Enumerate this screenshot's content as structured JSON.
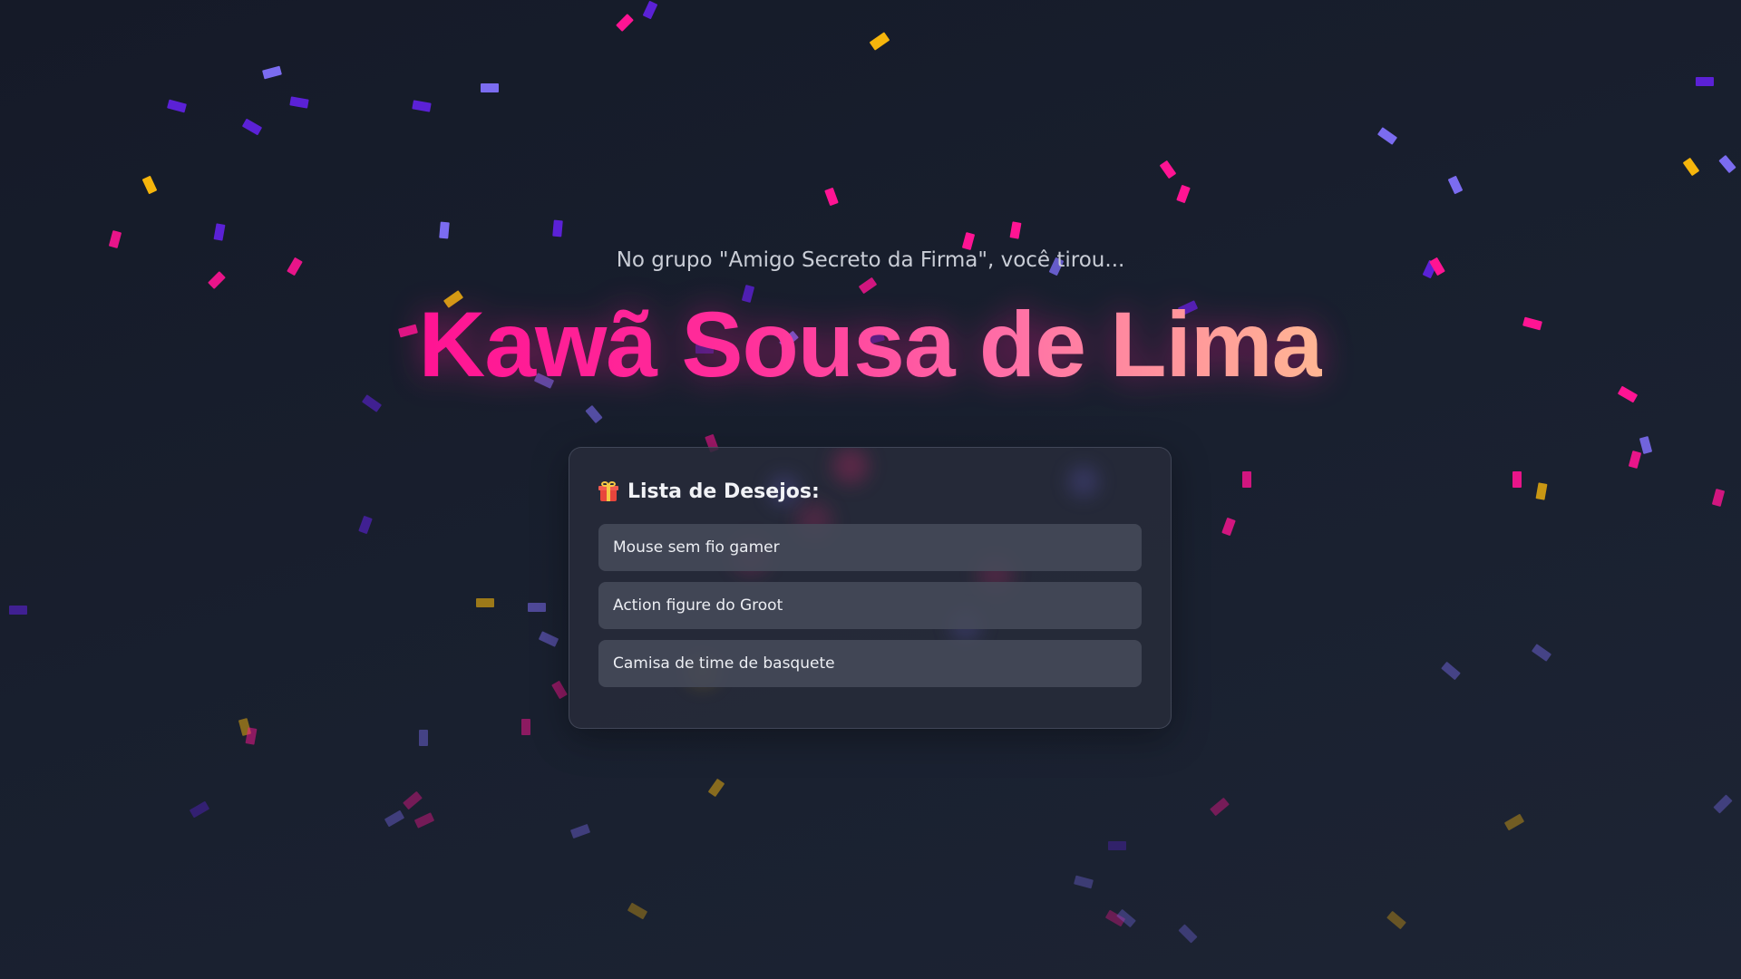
{
  "header": {
    "subtitle": "No grupo \"Amigo Secreto da Firma\", você tirou..."
  },
  "result": {
    "person_name": "Kawã Sousa de Lima"
  },
  "wishlist": {
    "icon": "gift-icon",
    "title": "Lista de Desejos:",
    "items": [
      "Mouse sem fio gamer",
      "Action figure do Groot",
      "Camisa de time de basquete"
    ]
  },
  "theme": {
    "background": "#171d2b",
    "name_gradient": [
      "#ff1493",
      "#ffb693"
    ],
    "confetti_colors": [
      "#ff1493",
      "#d91a7a",
      "#7b6cf0",
      "#5b21d6",
      "#f5b50c"
    ]
  }
}
